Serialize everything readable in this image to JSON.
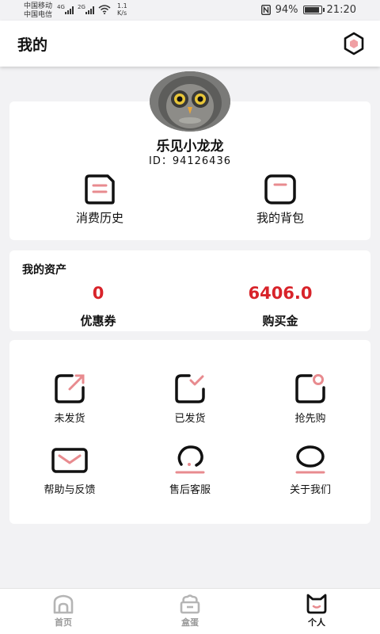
{
  "status": {
    "carrier1": "中国移动",
    "carrier2": "中国电信",
    "net1": "4G",
    "net2": "2G",
    "speed_value": "1.1",
    "speed_unit": "K/s",
    "battery": "94%",
    "battery_level": 0.94,
    "time": "21:20"
  },
  "header": {
    "title": "我的",
    "settings_icon": "settings-hexagon-icon"
  },
  "profile": {
    "username": "乐见小龙龙",
    "id": "ID：94126436",
    "items": [
      {
        "label": "消费历史",
        "icon": "receipt-icon"
      },
      {
        "label": "我的背包",
        "icon": "backpack-icon"
      }
    ]
  },
  "assets": {
    "title": "我的资产",
    "coupon_value": "0",
    "coupon_label": "优惠券",
    "credit_value": "6406.0",
    "credit_label": "购买金"
  },
  "menu": {
    "items": [
      {
        "label": "未发货",
        "icon": "unshipped-icon"
      },
      {
        "label": "已发货",
        "icon": "shipped-icon"
      },
      {
        "label": "抢先购",
        "icon": "presale-icon"
      },
      {
        "label": "帮助与反馈",
        "icon": "mail-icon"
      },
      {
        "label": "售后客服",
        "icon": "customer-service-icon"
      },
      {
        "label": "关于我们",
        "icon": "about-icon"
      }
    ]
  },
  "nav": {
    "items": [
      {
        "label": "首页",
        "icon": "home-icon",
        "active": false
      },
      {
        "label": "盒蛋",
        "icon": "box-egg-icon",
        "active": false
      },
      {
        "label": "个人",
        "icon": "cat-profile-icon",
        "active": true
      }
    ]
  },
  "colors": {
    "accent": "#d8232a",
    "pink": "#f0a0a4",
    "background": "#f2f2f4"
  }
}
